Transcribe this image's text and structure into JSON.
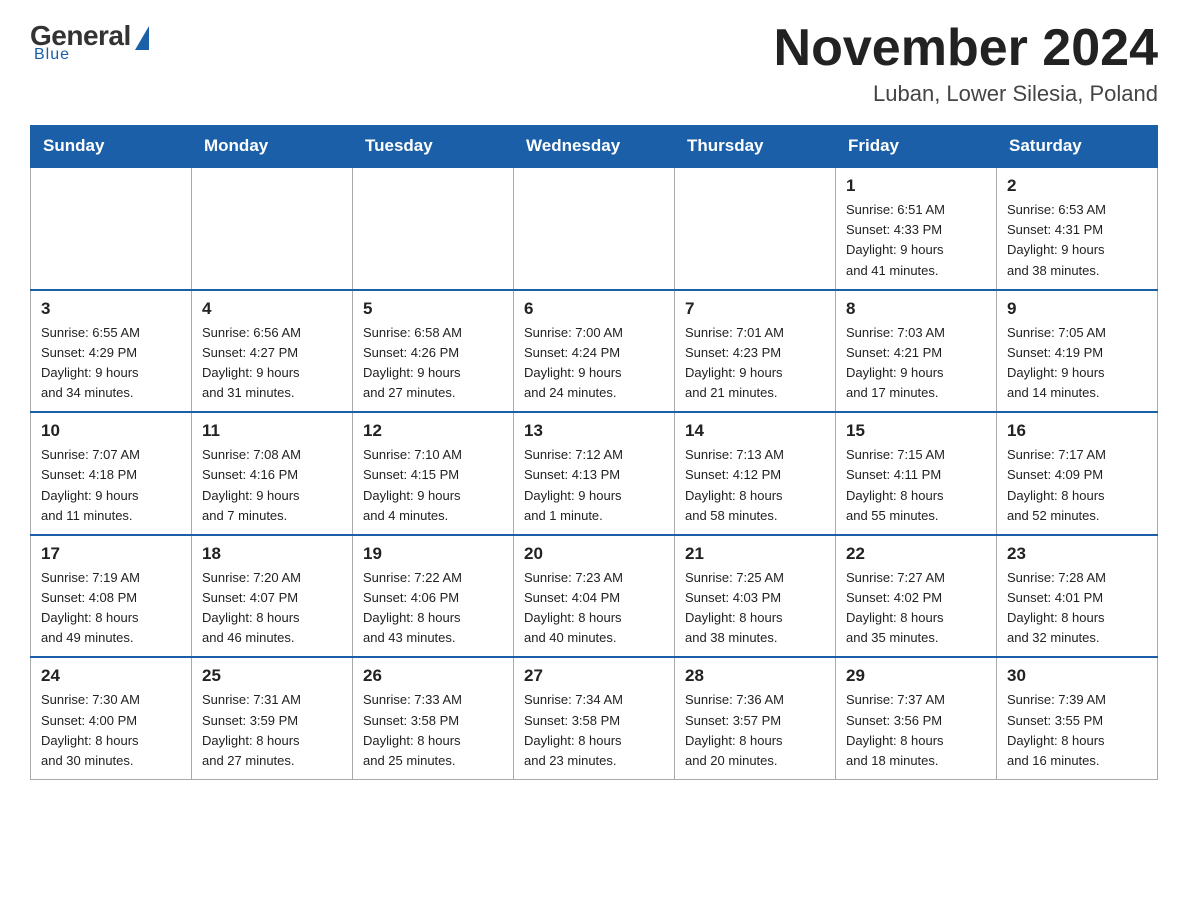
{
  "logo": {
    "general": "General",
    "blue": "Blue",
    "tagline": "Blue"
  },
  "header": {
    "month_year": "November 2024",
    "location": "Luban, Lower Silesia, Poland"
  },
  "weekdays": [
    "Sunday",
    "Monday",
    "Tuesday",
    "Wednesday",
    "Thursday",
    "Friday",
    "Saturday"
  ],
  "weeks": [
    [
      {
        "day": "",
        "info": ""
      },
      {
        "day": "",
        "info": ""
      },
      {
        "day": "",
        "info": ""
      },
      {
        "day": "",
        "info": ""
      },
      {
        "day": "",
        "info": ""
      },
      {
        "day": "1",
        "info": "Sunrise: 6:51 AM\nSunset: 4:33 PM\nDaylight: 9 hours\nand 41 minutes."
      },
      {
        "day": "2",
        "info": "Sunrise: 6:53 AM\nSunset: 4:31 PM\nDaylight: 9 hours\nand 38 minutes."
      }
    ],
    [
      {
        "day": "3",
        "info": "Sunrise: 6:55 AM\nSunset: 4:29 PM\nDaylight: 9 hours\nand 34 minutes."
      },
      {
        "day": "4",
        "info": "Sunrise: 6:56 AM\nSunset: 4:27 PM\nDaylight: 9 hours\nand 31 minutes."
      },
      {
        "day": "5",
        "info": "Sunrise: 6:58 AM\nSunset: 4:26 PM\nDaylight: 9 hours\nand 27 minutes."
      },
      {
        "day": "6",
        "info": "Sunrise: 7:00 AM\nSunset: 4:24 PM\nDaylight: 9 hours\nand 24 minutes."
      },
      {
        "day": "7",
        "info": "Sunrise: 7:01 AM\nSunset: 4:23 PM\nDaylight: 9 hours\nand 21 minutes."
      },
      {
        "day": "8",
        "info": "Sunrise: 7:03 AM\nSunset: 4:21 PM\nDaylight: 9 hours\nand 17 minutes."
      },
      {
        "day": "9",
        "info": "Sunrise: 7:05 AM\nSunset: 4:19 PM\nDaylight: 9 hours\nand 14 minutes."
      }
    ],
    [
      {
        "day": "10",
        "info": "Sunrise: 7:07 AM\nSunset: 4:18 PM\nDaylight: 9 hours\nand 11 minutes."
      },
      {
        "day": "11",
        "info": "Sunrise: 7:08 AM\nSunset: 4:16 PM\nDaylight: 9 hours\nand 7 minutes."
      },
      {
        "day": "12",
        "info": "Sunrise: 7:10 AM\nSunset: 4:15 PM\nDaylight: 9 hours\nand 4 minutes."
      },
      {
        "day": "13",
        "info": "Sunrise: 7:12 AM\nSunset: 4:13 PM\nDaylight: 9 hours\nand 1 minute."
      },
      {
        "day": "14",
        "info": "Sunrise: 7:13 AM\nSunset: 4:12 PM\nDaylight: 8 hours\nand 58 minutes."
      },
      {
        "day": "15",
        "info": "Sunrise: 7:15 AM\nSunset: 4:11 PM\nDaylight: 8 hours\nand 55 minutes."
      },
      {
        "day": "16",
        "info": "Sunrise: 7:17 AM\nSunset: 4:09 PM\nDaylight: 8 hours\nand 52 minutes."
      }
    ],
    [
      {
        "day": "17",
        "info": "Sunrise: 7:19 AM\nSunset: 4:08 PM\nDaylight: 8 hours\nand 49 minutes."
      },
      {
        "day": "18",
        "info": "Sunrise: 7:20 AM\nSunset: 4:07 PM\nDaylight: 8 hours\nand 46 minutes."
      },
      {
        "day": "19",
        "info": "Sunrise: 7:22 AM\nSunset: 4:06 PM\nDaylight: 8 hours\nand 43 minutes."
      },
      {
        "day": "20",
        "info": "Sunrise: 7:23 AM\nSunset: 4:04 PM\nDaylight: 8 hours\nand 40 minutes."
      },
      {
        "day": "21",
        "info": "Sunrise: 7:25 AM\nSunset: 4:03 PM\nDaylight: 8 hours\nand 38 minutes."
      },
      {
        "day": "22",
        "info": "Sunrise: 7:27 AM\nSunset: 4:02 PM\nDaylight: 8 hours\nand 35 minutes."
      },
      {
        "day": "23",
        "info": "Sunrise: 7:28 AM\nSunset: 4:01 PM\nDaylight: 8 hours\nand 32 minutes."
      }
    ],
    [
      {
        "day": "24",
        "info": "Sunrise: 7:30 AM\nSunset: 4:00 PM\nDaylight: 8 hours\nand 30 minutes."
      },
      {
        "day": "25",
        "info": "Sunrise: 7:31 AM\nSunset: 3:59 PM\nDaylight: 8 hours\nand 27 minutes."
      },
      {
        "day": "26",
        "info": "Sunrise: 7:33 AM\nSunset: 3:58 PM\nDaylight: 8 hours\nand 25 minutes."
      },
      {
        "day": "27",
        "info": "Sunrise: 7:34 AM\nSunset: 3:58 PM\nDaylight: 8 hours\nand 23 minutes."
      },
      {
        "day": "28",
        "info": "Sunrise: 7:36 AM\nSunset: 3:57 PM\nDaylight: 8 hours\nand 20 minutes."
      },
      {
        "day": "29",
        "info": "Sunrise: 7:37 AM\nSunset: 3:56 PM\nDaylight: 8 hours\nand 18 minutes."
      },
      {
        "day": "30",
        "info": "Sunrise: 7:39 AM\nSunset: 3:55 PM\nDaylight: 8 hours\nand 16 minutes."
      }
    ]
  ]
}
